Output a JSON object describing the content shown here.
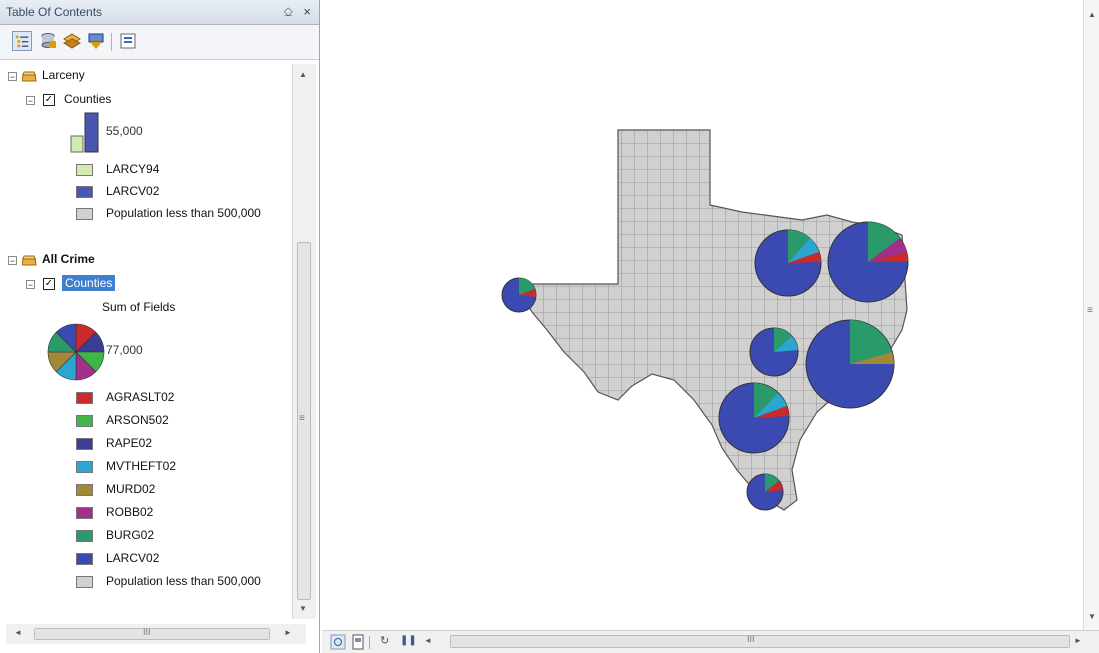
{
  "toc": {
    "title": "Table Of Contents",
    "pin_glyph": "⎐",
    "close_glyph": "×",
    "layers": [
      {
        "group_label": "Larceny",
        "layer_label": "Counties",
        "chart_value": "55,000",
        "legend": [
          {
            "label": "LARCY94",
            "color": "#d3eab0"
          },
          {
            "label": "LARCV02",
            "color": "#4a57b0"
          },
          {
            "label": "Population less than 500,000",
            "color": "#d0d0d0"
          }
        ]
      },
      {
        "group_label": "All Crime",
        "layer_label": "Counties",
        "field_caption": "Sum of Fields",
        "chart_value": "77,000",
        "legend": [
          {
            "label": "AGRASLT02",
            "color": "#cc2a2a"
          },
          {
            "label": "ARSON502",
            "color": "#3fb54a"
          },
          {
            "label": "RAPE02",
            "color": "#3a3e95"
          },
          {
            "label": "MVTHEFT02",
            "color": "#2aa6d0"
          },
          {
            "label": "MURD02",
            "color": "#a08a3a"
          },
          {
            "label": "ROBB02",
            "color": "#a0308a"
          },
          {
            "label": "BURG02",
            "color": "#2a9a6a"
          },
          {
            "label": "LARCV02",
            "color": "#3a4ab0"
          },
          {
            "label": "Population less than 500,000",
            "color": "#d0d0d0"
          }
        ]
      }
    ],
    "hscroll_grip": "III",
    "vscroll_grip": "≡"
  },
  "map": {
    "state_fill": "#d0d0d0",
    "pie_primary_color": "#3a4ab0",
    "hscroll_grip": "III",
    "vscroll_grip": "≡"
  }
}
